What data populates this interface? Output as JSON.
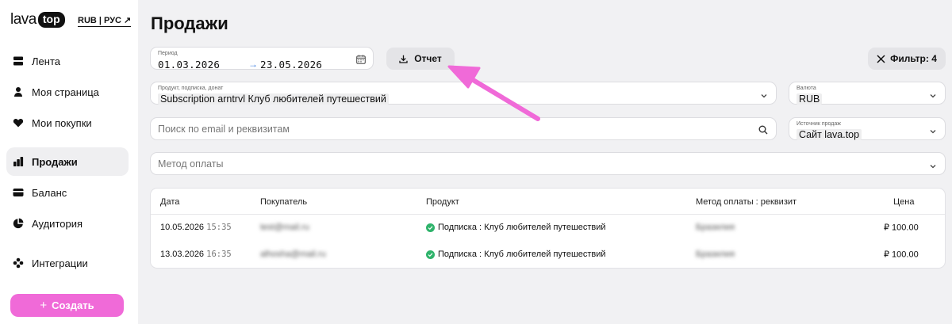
{
  "brand": {
    "logo_text": "lava",
    "logo_badge": "top",
    "locale": "RUB | РУС ↗"
  },
  "sidebar": {
    "items": [
      {
        "label": "Лента",
        "icon": "feed-icon"
      },
      {
        "label": "Моя страница",
        "icon": "user-icon"
      },
      {
        "label": "Мои покупки",
        "icon": "heart-icon"
      },
      {
        "label": "Продажи",
        "icon": "bar-chart-icon",
        "active": true
      },
      {
        "label": "Баланс",
        "icon": "card-icon"
      },
      {
        "label": "Аудитория",
        "icon": "pie-chart-icon"
      },
      {
        "label": "Интеграции",
        "icon": "integrations-icon"
      }
    ],
    "create_label": "Создать"
  },
  "page": {
    "title": "Продажи"
  },
  "filters": {
    "period": {
      "label": "Период",
      "from": "01.03.2026",
      "to": "23.05.2026"
    },
    "report_label": "Отчет",
    "filter_label": "Фильтр: 4",
    "product": {
      "label": "Продукт, подписка, донат",
      "value": "Subscription arntrvl Клуб любителей путешествий"
    },
    "currency": {
      "label": "Валюта",
      "value": "RUB"
    },
    "search": {
      "placeholder": "Поиск по email и реквизитам"
    },
    "source": {
      "label": "Источник продаж",
      "value": "Сайт lava.top"
    },
    "payment_method": {
      "placeholder": "Метод оплаты"
    }
  },
  "table": {
    "columns": [
      "Дата",
      "Покупатель",
      "Продукт",
      "Метод оплаты : реквизит",
      "Цена"
    ],
    "rows": [
      {
        "date": "10.05.2026",
        "time": "15:35",
        "buyer": "test@mail.ru",
        "product": "Подписка : Клуб любителей путешествий",
        "method": "Бразилия",
        "price": "₽ 100.00"
      },
      {
        "date": "13.03.2026",
        "time": "16:35",
        "buyer": "alhosha@mail.ru",
        "product": "Подписка : Клуб любителей путешествий",
        "method": "Бразилия",
        "price": "₽ 100.00"
      }
    ]
  },
  "colors": {
    "accent": "#f06ad8",
    "success": "#2fb36b",
    "link": "#3a7de0"
  }
}
